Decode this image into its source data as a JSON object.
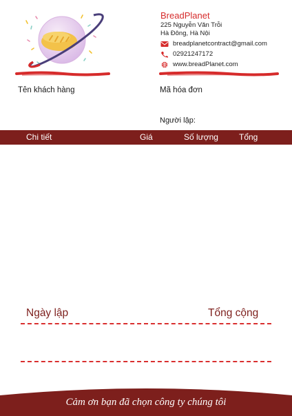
{
  "company": {
    "name": "BreadPlanet",
    "address_line1": "225 Nguyễn Văn Trỗi",
    "address_line2": "Hà Đông, Hà Nội",
    "email": "breadplanetcontract@gmail.com",
    "phone": "02921247172",
    "website": "www.breadPlanet.com"
  },
  "fields": {
    "customer_label": "Tên khách hàng",
    "invoice_label": "Mã hóa đơn",
    "creator_label": "Người lập:"
  },
  "table": {
    "headers": [
      "Chi tiết",
      "Giá",
      "Số lượng",
      "Tổng"
    ]
  },
  "summary": {
    "date_label": "Ngày lập",
    "total_label": "Tổng cộng"
  },
  "footer": {
    "thanks": "Cảm ơn bạn đã chọn công ty chúng tôi"
  },
  "colors": {
    "brand_red": "#d62b2b",
    "header_maroon": "#7d1f1c"
  },
  "icons": [
    "planet-bread-logo",
    "email-icon",
    "phone-icon",
    "globe-icon"
  ]
}
